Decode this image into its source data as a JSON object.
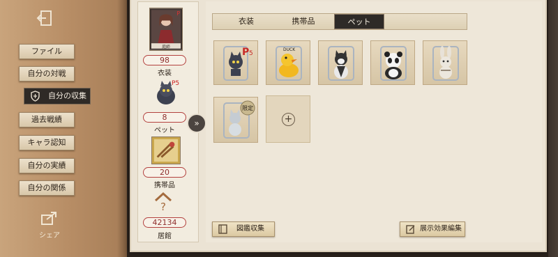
{
  "nav": {
    "items": [
      "ファイル",
      "自分の対戦",
      "自分の収集",
      "過去戦績",
      "キャラ認知",
      "自分の実績",
      "自分の関係"
    ],
    "active_index": 2,
    "share_label": "シェア"
  },
  "stats": [
    {
      "count": "98",
      "label": "衣装",
      "icon": "character-portrait"
    },
    {
      "count": "8",
      "label": "ペット",
      "icon": "pet-cat-portrait"
    },
    {
      "count": "20",
      "label": "携帯品",
      "icon": "accessory-stamp"
    },
    {
      "count": "42134",
      "label": "居館",
      "icon": "house-question-icon"
    }
  ],
  "portrait_caption": "庭師",
  "tabs": [
    "衣装",
    "携帯品",
    "ペット"
  ],
  "active_tab": "ペット",
  "pets": [
    {
      "name": "persona-cat-pet",
      "badge": "P5"
    },
    {
      "name": "yellow-duck-pet",
      "badge": "DUCK"
    },
    {
      "name": "cat-pet",
      "badge": ""
    },
    {
      "name": "panda-pet",
      "badge": ""
    },
    {
      "name": "rabbit-pet",
      "badge": ""
    },
    {
      "name": "limited-pet",
      "badge": "限定"
    }
  ],
  "buttons": {
    "catalog": "図鑑収集",
    "display_effect": "展示効果編集"
  },
  "colors": {
    "accent_red": "#b3413e",
    "dark_tab": "#2e2a27",
    "parchment": "#ebe3d4"
  }
}
